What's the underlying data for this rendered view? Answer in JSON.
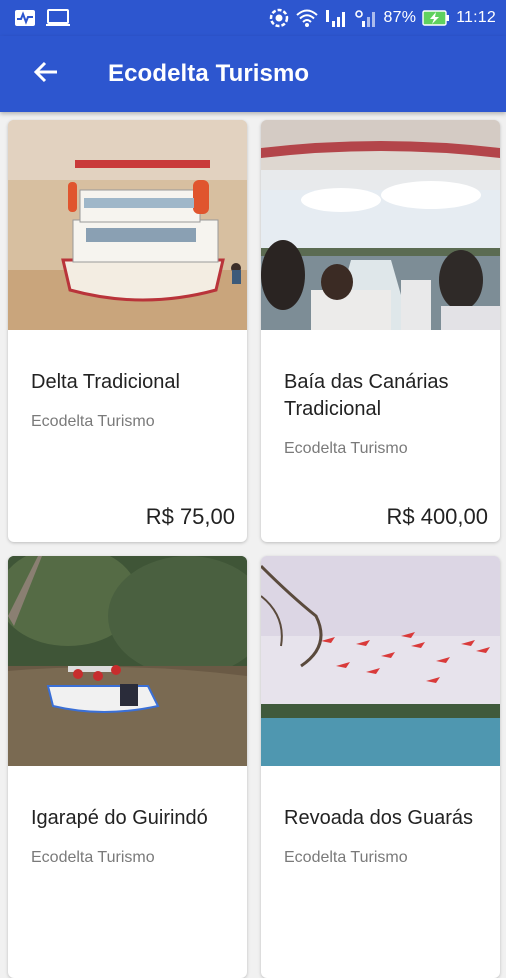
{
  "status_bar": {
    "battery": "87%",
    "time": "11:12",
    "left_icons": [
      "activity-icon",
      "cast-icon"
    ],
    "right_icons": [
      "sync-icon",
      "wifi-icon",
      "signal-icon",
      "signal-2-icon",
      "battery-charging-icon"
    ]
  },
  "app_bar": {
    "title": "Ecodelta Turismo",
    "back_icon": "arrow-back-icon",
    "color": "#2d56cf"
  },
  "tours": [
    {
      "title": "Delta Tradicional",
      "company": "Ecodelta Turismo",
      "price": "R$ 75,00",
      "image": "boat-on-river"
    },
    {
      "title": "Baía das Canárias Tradicional",
      "company": "Ecodelta Turismo",
      "price": "R$ 400,00",
      "image": "speedboat-passengers"
    },
    {
      "title": "Igarapé do Guirindó",
      "company": "Ecodelta Turismo",
      "price": "",
      "image": "jetboat-in-mangrove"
    },
    {
      "title": "Revoada dos Guarás",
      "company": "Ecodelta Turismo",
      "price": "",
      "image": "scarlet-ibis-flight"
    }
  ]
}
